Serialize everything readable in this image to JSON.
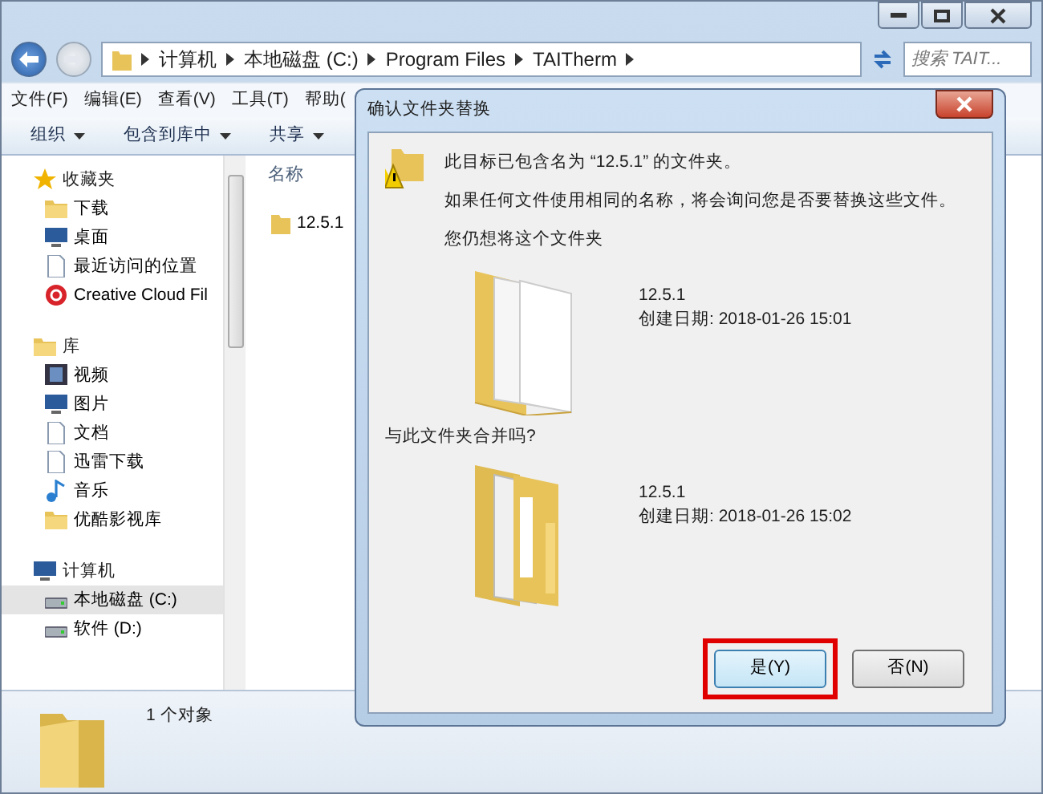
{
  "address_bar": {
    "breadcrumb": [
      "计算机",
      "本地磁盘 (C:)",
      "Program Files",
      "TAITherm"
    ],
    "search_placeholder": "搜索 TAIT..."
  },
  "menu": [
    "文件(F)",
    "编辑(E)",
    "查看(V)",
    "工具(T)",
    "帮助("
  ],
  "toolbar": [
    "组织",
    "包含到库中",
    "共享"
  ],
  "navigation": [
    {
      "label": "收藏夹",
      "kind": "star",
      "children": [
        {
          "label": "下载",
          "kind": "folder",
          "selected": false
        },
        {
          "label": "桌面",
          "kind": "screen",
          "selected": false
        },
        {
          "label": "最近访问的位置",
          "kind": "doc",
          "selected": false
        },
        {
          "label": "Creative Cloud Fil",
          "kind": "cloud",
          "selected": false
        }
      ]
    },
    {
      "label": "库",
      "kind": "folder",
      "children": [
        {
          "label": "视频",
          "kind": "media",
          "selected": false
        },
        {
          "label": "图片",
          "kind": "screen",
          "selected": false
        },
        {
          "label": "文档",
          "kind": "doc",
          "selected": false
        },
        {
          "label": "迅雷下载",
          "kind": "doc",
          "selected": false
        },
        {
          "label": "音乐",
          "kind": "music",
          "selected": false
        },
        {
          "label": "优酷影视库",
          "kind": "folder",
          "selected": false
        }
      ]
    },
    {
      "label": "计算机",
      "kind": "screen",
      "children": [
        {
          "label": "本地磁盘 (C:)",
          "kind": "drive",
          "selected": true
        },
        {
          "label": "软件 (D:)",
          "kind": "drive",
          "selected": false
        }
      ]
    }
  ],
  "file_list": {
    "column": "名称",
    "items": [
      {
        "name": "12.5.1",
        "selected": false
      }
    ]
  },
  "status_bar": {
    "text": "1 个对象"
  },
  "dialog": {
    "title": "确认文件夹替换",
    "message": "此目标已包含名为 “12.5.1” 的文件夹。",
    "detail": "如果任何文件使用相同的名称，将会询问您是否要替换这些文件。",
    "question": "您仍想将这个文件夹",
    "existing": {
      "name": "12.5.1",
      "date": "创建日期: 2018-01-26 15:01"
    },
    "merge_prompt": "与此文件夹合并吗?",
    "source": {
      "name": "12.5.1",
      "date": "创建日期: 2018-01-26 15:02"
    },
    "buttons": [
      {
        "label": "是(Y)",
        "default": true,
        "highlighted": true
      },
      {
        "label": "否(N)",
        "default": false,
        "highlighted": false
      }
    ]
  }
}
